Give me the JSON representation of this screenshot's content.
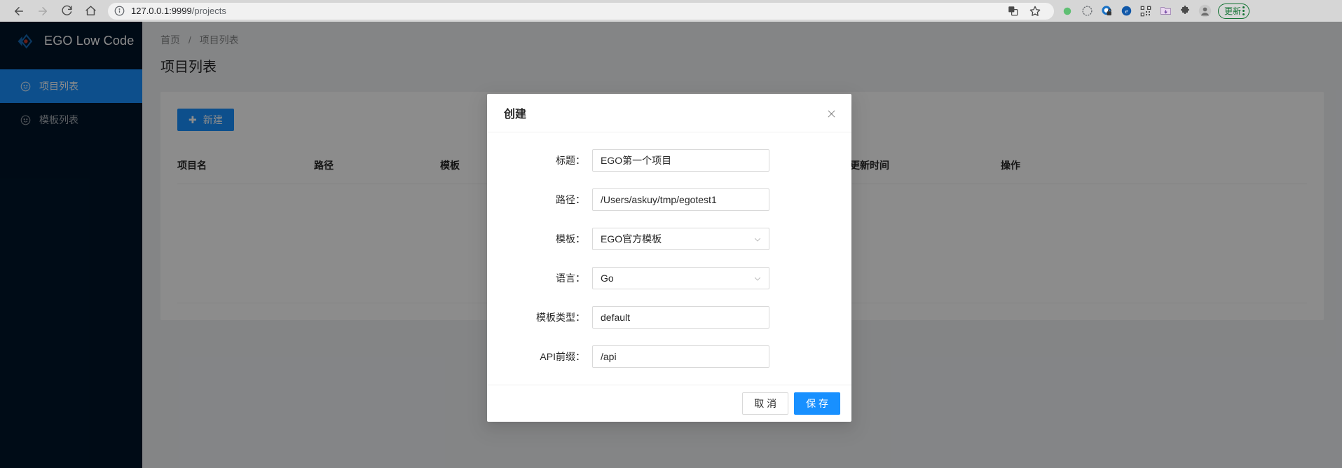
{
  "browser": {
    "back_icon": "arrow-left-icon",
    "forward_icon": "arrow-right-icon",
    "reload_icon": "reload-icon",
    "home_icon": "home-icon",
    "info_icon": "site-info-icon",
    "url_host": "127.0.0.1:9999",
    "url_path": "/projects",
    "url_full": "127.0.0.1:9999/projects",
    "toolbar_icons": [
      "translate-icon",
      "bookmark-star-icon",
      "green-dot-extension-icon",
      "dashed-circle-extension-icon",
      "lock-shield-extension-icon",
      "edge-e-extension-icon",
      "qr-code-extension-icon",
      "folder-download-extension-icon",
      "puzzle-extensions-icon",
      "profile-avatar-icon"
    ],
    "update_label": "更新",
    "menu_icon": "three-dot-menu-icon"
  },
  "sidebar": {
    "logo_icon": "ego-diamond-logo",
    "brand": "EGO Low Code",
    "items": [
      {
        "label": "项目列表",
        "icon": "smiley-face-icon",
        "active": true
      },
      {
        "label": "模板列表",
        "icon": "smiley-face-icon",
        "active": false
      }
    ]
  },
  "breadcrumb": {
    "home": "首页",
    "separator": "/",
    "current": "项目列表"
  },
  "page": {
    "title": "项目列表"
  },
  "toolbar": {
    "new_label": "新建",
    "new_icon": "plus-icon"
  },
  "table": {
    "columns": [
      {
        "label": "项目名"
      },
      {
        "label": "路径"
      },
      {
        "label": "模板"
      },
      {
        "label": "更新时间"
      },
      {
        "label": "操作"
      }
    ],
    "rows": []
  },
  "modal": {
    "title": "创建",
    "close_icon": "close-x-icon",
    "fields": [
      {
        "label": "标题：",
        "value": "EGO第一个项目",
        "type": "text",
        "name": "title"
      },
      {
        "label": "路径：",
        "value": "/Users/askuy/tmp/egotest1",
        "type": "text",
        "name": "path"
      },
      {
        "label": "模板：",
        "value": "EGO官方模板",
        "type": "select",
        "name": "template"
      },
      {
        "label": "语言：",
        "value": "Go",
        "type": "select",
        "name": "language"
      },
      {
        "label": "模板类型：",
        "value": "default",
        "type": "text",
        "name": "template-type"
      },
      {
        "label": "API前缀：",
        "value": "/api",
        "type": "text",
        "name": "api-prefix"
      }
    ],
    "cancel_label": "取 消",
    "save_label": "保 存"
  },
  "colors": {
    "primary": "#1890ff",
    "sidebar_bg": "#001529",
    "page_bg": "#f0f2f5",
    "update_green": "#137333"
  }
}
